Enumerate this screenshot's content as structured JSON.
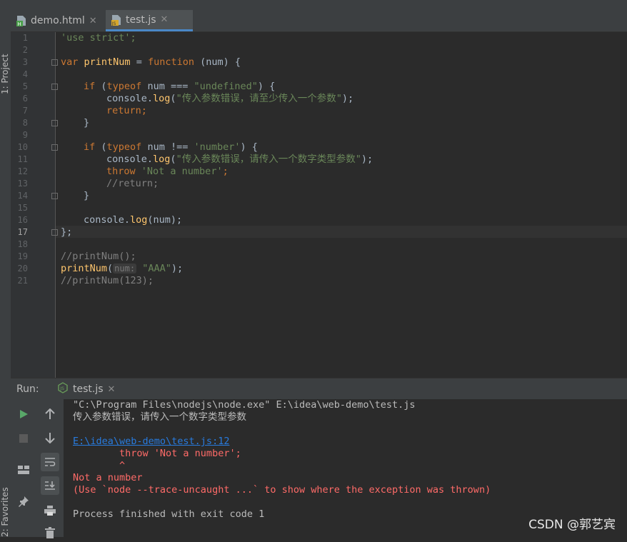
{
  "sidebar": {
    "project_label": "1: Project",
    "favorites_label": "2: Favorites"
  },
  "tabs": [
    {
      "label": "demo.html",
      "icon": "html-file-icon",
      "active": false
    },
    {
      "label": "test.js",
      "icon": "js-file-icon",
      "active": true
    }
  ],
  "editor": {
    "line_numbers": [
      "1",
      "2",
      "3",
      "4",
      "5",
      "6",
      "7",
      "8",
      "9",
      "10",
      "11",
      "12",
      "13",
      "14",
      "15",
      "16",
      "17",
      "18",
      "19",
      "20",
      "21"
    ],
    "current_line": "17",
    "code": {
      "l1": "'use strict';",
      "l3_kw": "var",
      "l3_fn": "printNum",
      "l3_eq": " = ",
      "l3_kw2": "function",
      "l3_rest": " (num) {",
      "l5_kw": "if",
      "l5_a": " (",
      "l5_kw2": "typeof",
      "l5_b": " num === ",
      "l5_str": "\"undefined\"",
      "l5_c": ") {",
      "l6_a": "console.",
      "l6_fn": "log",
      "l6_b": "(",
      "l6_str": "\"传入参数错误，请至少传入一个参数\"",
      "l6_c": ");",
      "l7": "return;",
      "l8": "}",
      "l10_kw": "if",
      "l10_a": " (",
      "l10_kw2": "typeof",
      "l10_b": " num !== ",
      "l10_str": "'number'",
      "l10_c": ") {",
      "l11_a": "console.",
      "l11_fn": "log",
      "l11_b": "(",
      "l11_str": "\"传入参数错误，请传入一个数字类型参数\"",
      "l11_c": ");",
      "l12_kw": "throw",
      "l12_str": "'Not a number'",
      "l12_c": ";",
      "l13": "//return;",
      "l14": "}",
      "l16_a": "console.",
      "l16_fn": "log",
      "l16_b": "(num);",
      "l17": "};",
      "l19": "//printNum();",
      "l20_fn": "printNum",
      "l20_a": "(",
      "l20_hint": "num:",
      "l20_str": "\"AAA\"",
      "l20_b": ");",
      "l21": "//printNum(123);"
    }
  },
  "run": {
    "label": "Run:",
    "tab_label": "test.js",
    "console": {
      "cmd": "\"C:\\Program Files\\nodejs\\node.exe\" E:\\idea\\web-demo\\test.js",
      "out1": "传入参数错误，请传入一个数字类型参数",
      "link": "E:\\idea\\web-demo\\test.js:12",
      "err1": "        throw 'Not a number';",
      "err2": "        ^",
      "err3": "Not a number",
      "err4": "(Use `node --trace-uncaught ...` to show where the exception was thrown)",
      "exit": "Process finished with exit code 1"
    }
  },
  "watermark": "CSDN @郭艺宾",
  "colors": {
    "accent": "#4a88c7",
    "keyword": "#cc7832",
    "string": "#6a8759",
    "function": "#ffc66d",
    "error": "#ff6b68",
    "link": "#287bde"
  }
}
